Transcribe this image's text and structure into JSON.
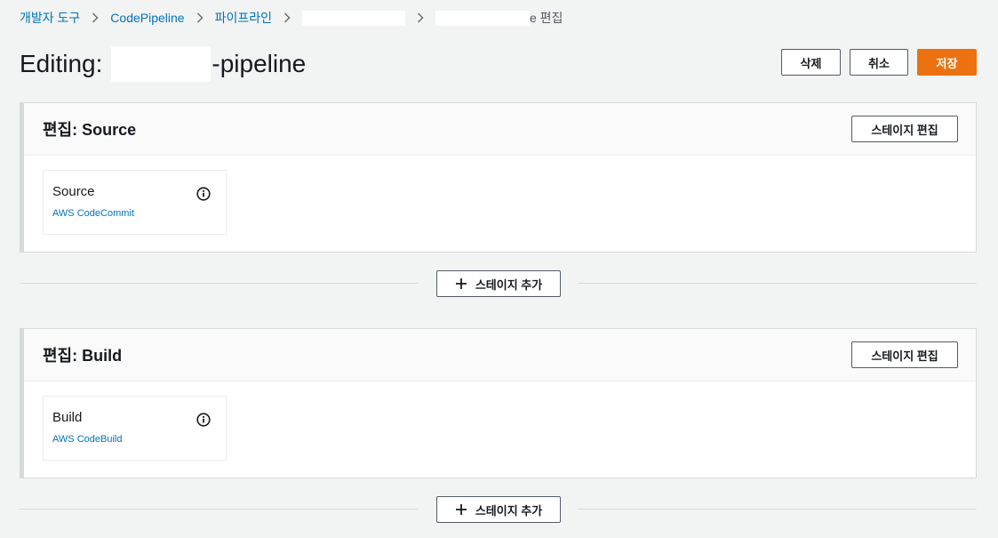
{
  "breadcrumb": {
    "items": [
      "개발자 도구",
      "CodePipeline",
      "파이프라인"
    ],
    "current_suffix": "e 편집"
  },
  "page": {
    "title_prefix": "Editing:",
    "title_suffix": "-pipeline"
  },
  "actions": {
    "delete": "삭제",
    "cancel": "취소",
    "save": "저장"
  },
  "stages": [
    {
      "title": "편집: Source",
      "edit_button": "스테이지 편집",
      "action": {
        "name": "Source",
        "provider": "AWS CodeCommit",
        "icon": "info-icon"
      }
    },
    {
      "title": "편집: Build",
      "edit_button": "스테이지 편집",
      "action": {
        "name": "Build",
        "provider": "AWS CodeBuild",
        "icon": "info-icon"
      }
    }
  ],
  "add_stage_label": "스테이지 추가",
  "colors": {
    "link": "#0073bb",
    "primary": "#ec7211",
    "background": "#f2f3f3"
  }
}
